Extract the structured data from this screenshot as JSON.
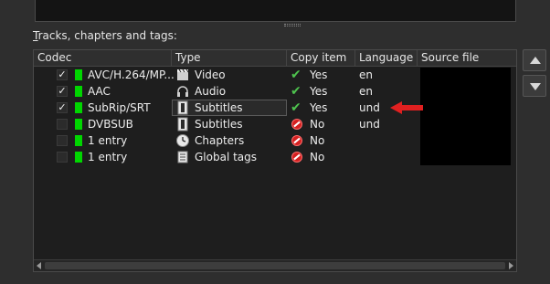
{
  "section_label": {
    "prefix": "",
    "mnemonic": "T",
    "rest": "racks, chapters and tags:"
  },
  "columns": [
    "Codec",
    "Type",
    "Copy item",
    "Language",
    "Source file"
  ],
  "rows": [
    {
      "checked": true,
      "codec": "AVC/H.264/MP...",
      "type_icon": "video-clapper-icon",
      "type": "Video",
      "copy": "Yes",
      "copy_state": "yes",
      "language": "en"
    },
    {
      "checked": true,
      "codec": "AAC",
      "type_icon": "headphones-icon",
      "type": "Audio",
      "copy": "Yes",
      "copy_state": "yes",
      "language": "en"
    },
    {
      "checked": true,
      "codec": "SubRip/SRT",
      "type_icon": "subtitles-doc-icon",
      "type": "Subtitles",
      "copy": "Yes",
      "copy_state": "yes",
      "language": "und"
    },
    {
      "checked": false,
      "codec": "DVBSUB",
      "type_icon": "subtitles-doc-icon",
      "type": "Subtitles",
      "copy": "No",
      "copy_state": "no",
      "language": "und"
    },
    {
      "checked": false,
      "codec": "1 entry",
      "type_icon": "clock-icon",
      "type": "Chapters",
      "copy": "No",
      "copy_state": "no",
      "language": ""
    },
    {
      "checked": false,
      "codec": "1 entry",
      "type_icon": "tags-icon",
      "type": "Global tags",
      "copy": "No",
      "copy_state": "no",
      "language": ""
    }
  ],
  "colors": {
    "accent_green": "#00d600",
    "yes_green": "#4ec34e",
    "no_red": "#d42020",
    "annotation_arrow": "#e02020"
  },
  "side_buttons": {
    "up_icon": "up-arrow-icon",
    "down_icon": "down-arrow-icon"
  }
}
